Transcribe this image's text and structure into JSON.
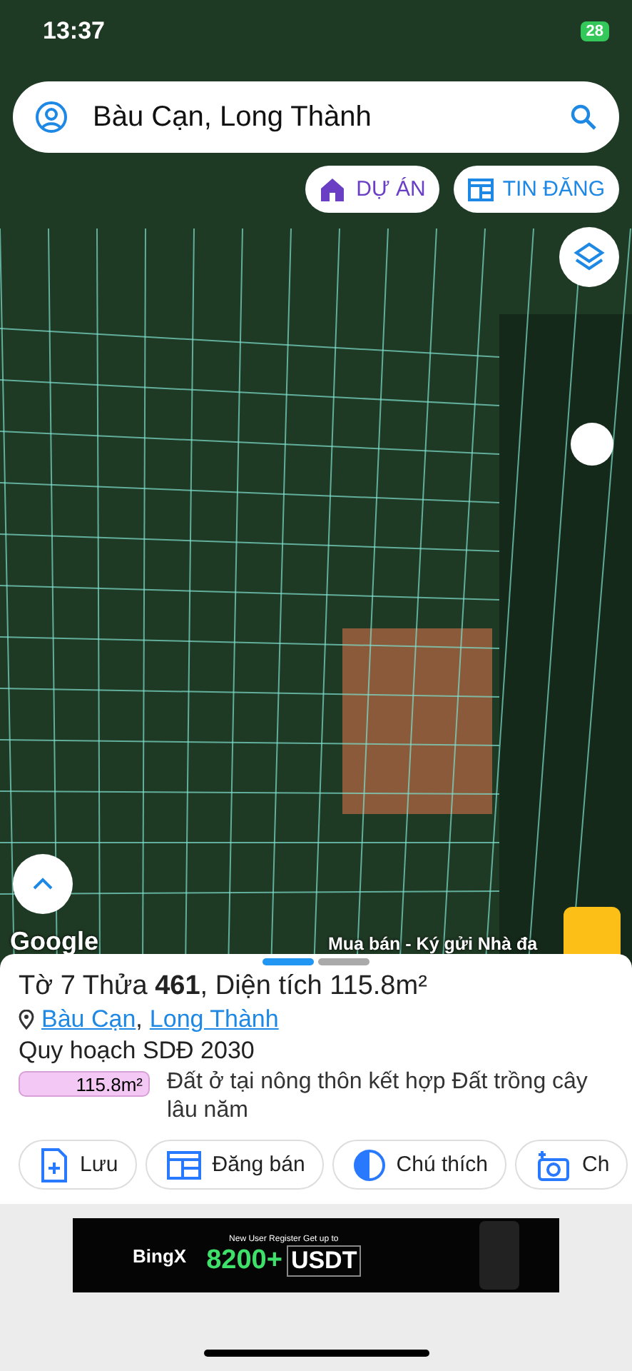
{
  "status_bar": {
    "time": "13:37",
    "battery": "28"
  },
  "search": {
    "value": "Bàu Cạn, Long Thành"
  },
  "map_chips": [
    {
      "label": "DỰ ÁN",
      "kind": "project"
    },
    {
      "label": "TIN ĐĂNG",
      "kind": "listing"
    }
  ],
  "map": {
    "attribution": "Google",
    "banner_text": "Mua bán - Ký gửi Nhà đa"
  },
  "sheet": {
    "pages": [
      {
        "selected": true
      },
      {
        "selected": false
      }
    ],
    "title": "Tờ 7 Thửa **461**, Diện tích 115.8m²",
    "location": [
      "Bàu Cạn",
      "Long Thành"
    ],
    "location_separator": ",",
    "planning_title": "Quy hoạch SDĐ 2030",
    "legend": [
      {
        "area": "115.8m²",
        "color": "#f4c8f4",
        "description": "Đất ở tại nông thôn kết hợp Đất trồng cây lâu năm"
      }
    ],
    "actions": [
      {
        "label": "Lưu",
        "kind": "save"
      },
      {
        "label": "Đăng bán",
        "kind": "post"
      },
      {
        "label": "Chú thích",
        "kind": "legend"
      },
      {
        "label": "Ch",
        "kind": "camera"
      }
    ]
  },
  "ad": {
    "headline": "New User Register Get up to",
    "brand": "BingX",
    "amount": "8200+",
    "currency": "USDT"
  }
}
